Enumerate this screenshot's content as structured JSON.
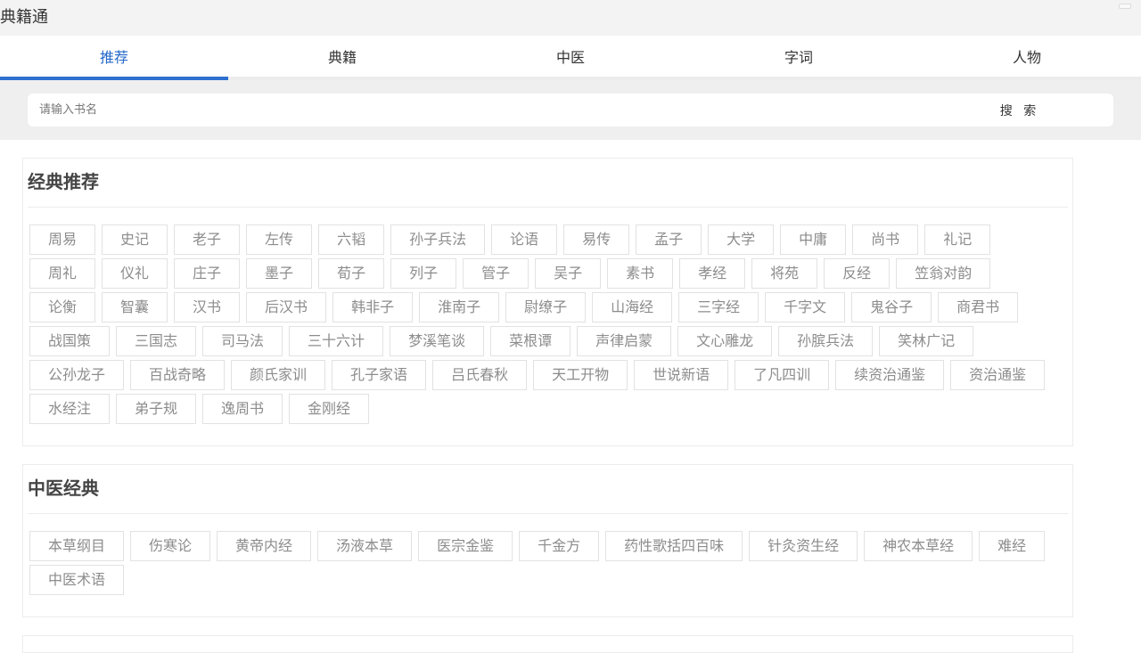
{
  "app": {
    "title": "典籍通"
  },
  "tabs": [
    {
      "label": "推荐"
    },
    {
      "label": "典籍"
    },
    {
      "label": "中医"
    },
    {
      "label": "字词"
    },
    {
      "label": "人物"
    }
  ],
  "search": {
    "placeholder": "请输入书名",
    "button_label": "搜 索"
  },
  "sections": [
    {
      "title": "经典推荐",
      "items": [
        "周易",
        "史记",
        "老子",
        "左传",
        "六韬",
        "孙子兵法",
        "论语",
        "易传",
        "孟子",
        "大学",
        "中庸",
        "尚书",
        "礼记",
        "周礼",
        "仪礼",
        "庄子",
        "墨子",
        "荀子",
        "列子",
        "管子",
        "吴子",
        "素书",
        "孝经",
        "将苑",
        "反经",
        "笠翁对韵",
        "论衡",
        "智囊",
        "汉书",
        "后汉书",
        "韩非子",
        "淮南子",
        "尉缭子",
        "山海经",
        "三字经",
        "千字文",
        "鬼谷子",
        "商君书",
        "战国策",
        "三国志",
        "司马法",
        "三十六计",
        "梦溪笔谈",
        "菜根谭",
        "声律启蒙",
        "文心雕龙",
        "孙膑兵法",
        "笑林广记",
        "公孙龙子",
        "百战奇略",
        "颜氏家训",
        "孔子家语",
        "吕氏春秋",
        "天工开物",
        "世说新语",
        "了凡四训",
        "续资治通鉴",
        "资治通鉴",
        "水经注",
        "弟子规",
        "逸周书",
        "金刚经"
      ]
    },
    {
      "title": "中医经典",
      "items": [
        "本草纲目",
        "伤寒论",
        "黄帝内经",
        "汤液本草",
        "医宗金鉴",
        "千金方",
        "药性歌括四百味",
        "针灸资生经",
        "神农本草经",
        "难经",
        "中医术语"
      ]
    }
  ],
  "colors": {
    "accent": "#2f6fcf",
    "active_tab_text": "#2468c9",
    "tag_text": "#8c8c8c",
    "tag_border": "#e2e2e2",
    "header_bg": "#f3f3f3",
    "search_area_bg": "#efefef"
  }
}
